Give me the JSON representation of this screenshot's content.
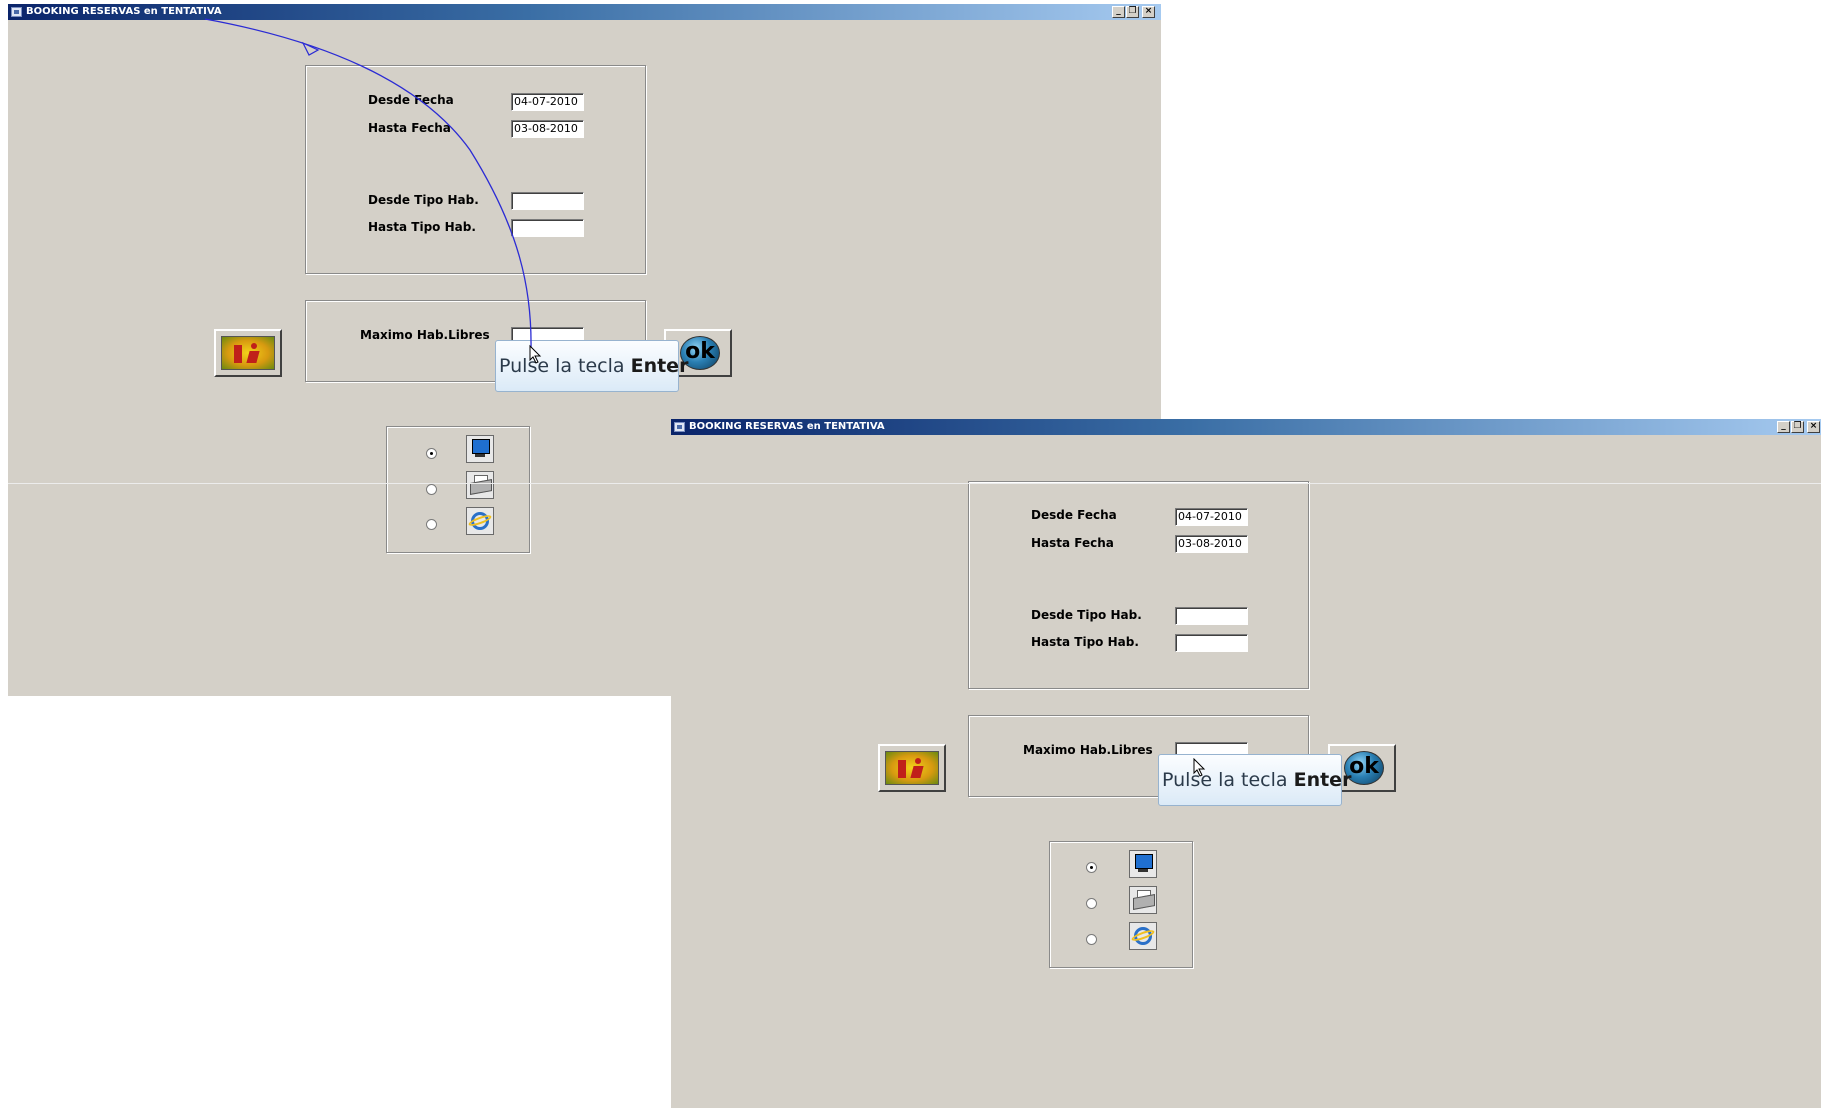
{
  "window_title": "BOOKING RESERVAS en TENTATIVA",
  "labels": {
    "desde_fecha": "Desde  Fecha",
    "hasta_fecha": "Hasta  Fecha",
    "desde_tipo": "Desde  Tipo Hab.",
    "hasta_tipo": "Hasta  Tipo Hab.",
    "maximo": "Maximo Hab.Libres"
  },
  "fields": {
    "desde_fecha": "04-07-2010",
    "hasta_fecha": "03-08-2010",
    "desde_tipo": "",
    "hasta_tipo": "",
    "maximo": ""
  },
  "ok_label": "ok",
  "tooltip": {
    "prefix": "Pulse la tecla ",
    "key": "Enter"
  },
  "output_options": [
    {
      "icon": "monitor-icon",
      "checked": true
    },
    {
      "icon": "printer-icon",
      "checked": false
    },
    {
      "icon": "internet-explorer-icon",
      "checked": false
    }
  ],
  "colors": {
    "window_bg": "#d4d0c8",
    "titlebar": "#0a246a",
    "arrow": "#2b2bd4"
  }
}
